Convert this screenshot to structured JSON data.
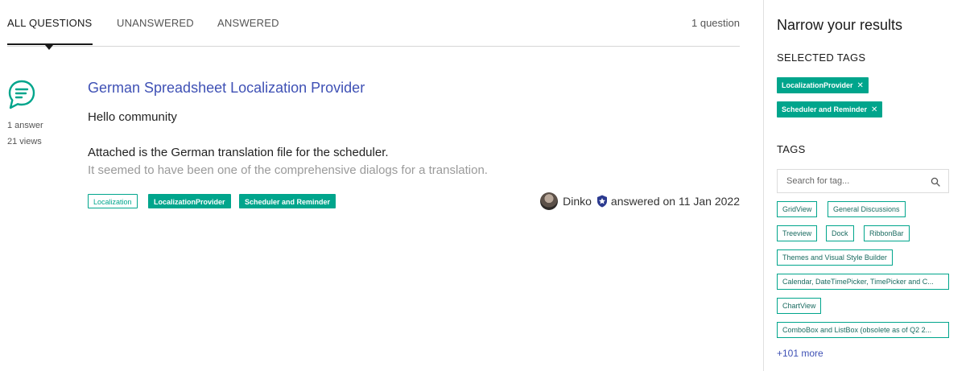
{
  "tabs": {
    "all": "ALL QUESTIONS",
    "unanswered": "UNANSWERED",
    "answered": "ANSWERED",
    "count": "1 question"
  },
  "question": {
    "icon": "chat-bubble-icon",
    "answers": "1 answer",
    "views": "21 views",
    "title": "German Spreadsheet Localization Provider",
    "body_line1": "Hello community",
    "body_line2": "Attached is the German translation file for the scheduler.",
    "body_line3": "It seemed to have been one of the comprehensive dialogs for a translation.",
    "tags": [
      "Localization",
      "LocalizationProvider",
      "Scheduler and Reminder"
    ],
    "author": "Dinko",
    "answered_text": "answered on 11 Jan 2022"
  },
  "sidebar": {
    "title": "Narrow your results",
    "selected_heading": "SELECTED TAGS",
    "selected_tags": [
      "LocalizationProvider",
      "Scheduler and Reminder"
    ],
    "tags_heading": "TAGS",
    "search_placeholder": "Search for tag...",
    "tags": [
      "GridView",
      "General Discussions",
      "Treeview",
      "Dock",
      "RibbonBar",
      "Themes and Visual Style Builder",
      "Calendar, DateTimePicker, TimePicker and C...",
      "ChartView",
      "ComboBox and ListBox (obsolete as of Q2 2..."
    ],
    "more": "+101 more"
  },
  "colors": {
    "accent": "#00a58c",
    "link": "#3f51b5"
  }
}
